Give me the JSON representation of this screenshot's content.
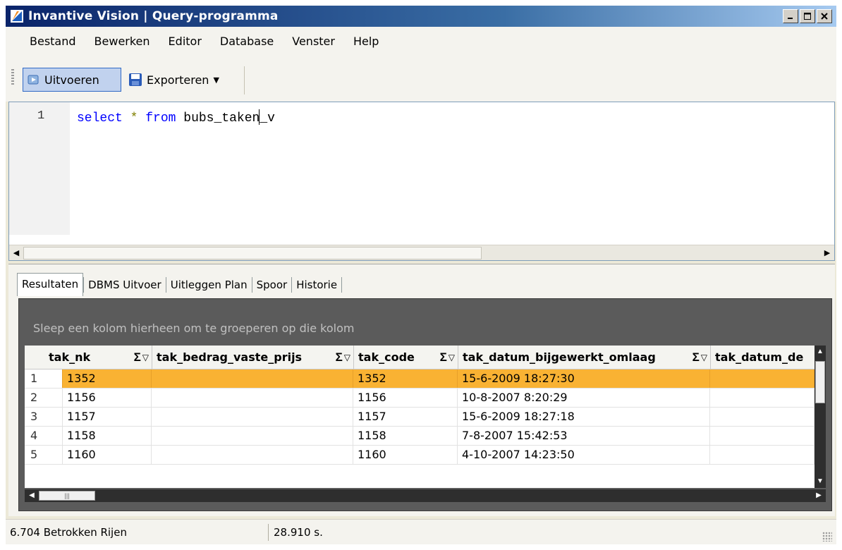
{
  "window": {
    "title": "Invantive Vision | Query-programma"
  },
  "menu": [
    "Bestand",
    "Bewerken",
    "Editor",
    "Database",
    "Venster",
    "Help"
  ],
  "toolbar": {
    "run_label": "Uitvoeren",
    "export_label": "Exporteren"
  },
  "editor": {
    "line_number": "1",
    "tokens": {
      "kw1": "select",
      "star": "*",
      "kw2": "from",
      "ident_before_cursor": "bubs_taken",
      "ident_after_cursor": "_v"
    }
  },
  "results": {
    "tabs": [
      "Resultaten",
      "DBMS Uitvoer",
      "Uitleggen Plan",
      "Spoor",
      "Historie"
    ],
    "active_tab": "Resultaten",
    "group_hint": "Sleep een kolom hierheen om te groeperen op die kolom",
    "columns": [
      "tak_nk",
      "tak_bedrag_vaste_prijs",
      "tak_code",
      "tak_datum_bijgewerkt_omlaag",
      "tak_datum_de"
    ],
    "rows": [
      {
        "index": "1",
        "tak_nk": "1352",
        "tak_bedrag_vaste_prijs": "",
        "tak_code": "1352",
        "tak_datum_bijgewerkt_omlaag": "15-6-2009 18:27:30",
        "tak_datum_de": ""
      },
      {
        "index": "2",
        "tak_nk": "1156",
        "tak_bedrag_vaste_prijs": "",
        "tak_code": "1156",
        "tak_datum_bijgewerkt_omlaag": "10-8-2007 8:20:29",
        "tak_datum_de": ""
      },
      {
        "index": "3",
        "tak_nk": "1157",
        "tak_bedrag_vaste_prijs": "",
        "tak_code": "1157",
        "tak_datum_bijgewerkt_omlaag": "15-6-2009 18:27:18",
        "tak_datum_de": ""
      },
      {
        "index": "4",
        "tak_nk": "1158",
        "tak_bedrag_vaste_prijs": "",
        "tak_code": "1158",
        "tak_datum_bijgewerkt_omlaag": "7-8-2007 15:42:53",
        "tak_datum_de": ""
      },
      {
        "index": "5",
        "tak_nk": "1160",
        "tak_bedrag_vaste_prijs": "",
        "tak_code": "1160",
        "tak_datum_bijgewerkt_omlaag": "4-10-2007 14:23:50",
        "tak_datum_de": ""
      }
    ],
    "selected_row": 0
  },
  "status": {
    "rows": "6.704 Betrokken Rijen",
    "time": "28.910 s."
  },
  "colors": {
    "title_gradient_start": "#0a246a",
    "selected_row": "#f9b233",
    "keyword": "#0000ff",
    "group_panel": "#5b5b5b"
  },
  "icons": {
    "app": "vision-app-icon",
    "run": "run-icon",
    "export": "save-disk-icon"
  }
}
